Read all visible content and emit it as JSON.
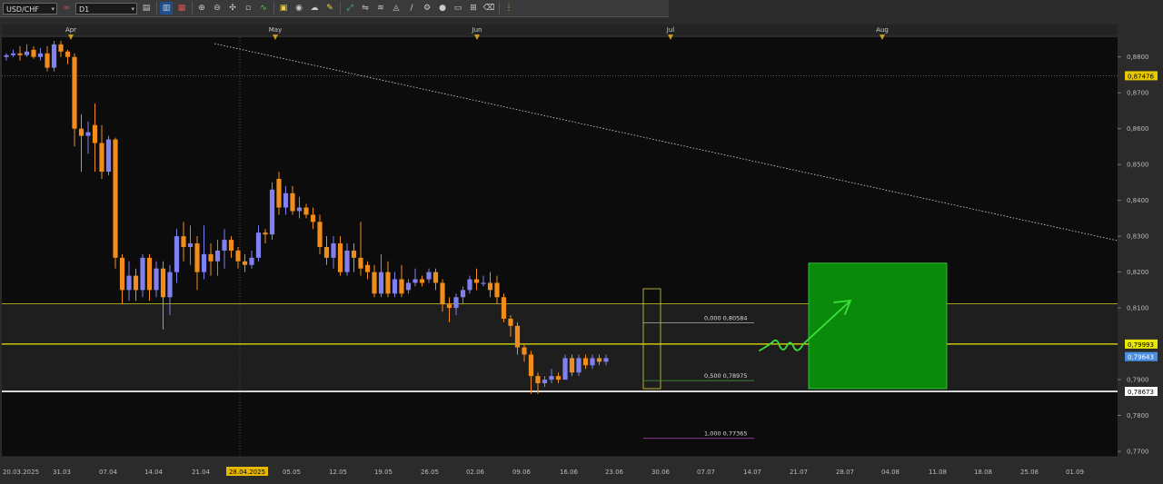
{
  "toolbar": {
    "symbol": "USD/CHF",
    "timeframe": "D1",
    "icons": [
      "chart-type-icon",
      "bar-style-icon",
      "line-style-icon",
      "zoom-in-icon",
      "zoom-out-icon",
      "crosshair-icon",
      "grid-icon",
      "indicator-icon",
      "template-icon",
      "screenshot-icon",
      "pencil-icon",
      "line-tool-icon",
      "channel-tool-icon",
      "fibo-tool-icon",
      "shapes-icon",
      "text-tool-icon",
      "settings-icon",
      "eraser-icon",
      "more-icon"
    ]
  },
  "chart_data": {
    "type": "candlestick",
    "symbol": "USD/CHF",
    "timeframe": "D1",
    "ylim": [
      0.7685,
      0.8855
    ],
    "y_ticks": [
      "0,8800",
      "0,8700",
      "0,8600",
      "0,8500",
      "0,8400",
      "0,8300",
      "0,8200",
      "0,8100",
      "0,7900",
      "0,7800",
      "0,7700"
    ],
    "month_labels": [
      "Apr",
      "May",
      "Jun",
      "Jul",
      "Aug"
    ],
    "date_labels": [
      "20.03.2025",
      "31.03",
      "07.04",
      "14.04",
      "21.04",
      "28.04.2025",
      "05.05",
      "12.05",
      "19.05",
      "26.05",
      "02.06",
      "09.06",
      "16.06",
      "23.06",
      "30.06",
      "07.07",
      "14.07",
      "21.07",
      "28.07",
      "04.08",
      "11.08",
      "18.08",
      "25.08",
      "01.09"
    ],
    "price_tags": [
      {
        "label": "0,87476",
        "value": 0.87476,
        "bg": "#e8c800",
        "fg": "#000000"
      },
      {
        "label": "0,79993",
        "value": 0.79993,
        "bg": "#e8e800",
        "fg": "#000000"
      },
      {
        "label": "0,79643",
        "value": 0.79643,
        "bg": "#4a8fe0",
        "fg": "#ffffff"
      },
      {
        "label": "0,78673",
        "value": 0.78673,
        "bg": "#ffffff",
        "fg": "#000000"
      }
    ],
    "horizontal_levels": [
      0.8112,
      0.79993,
      0.78673
    ],
    "fib_levels": [
      {
        "label": "0,000 0,80584",
        "value": 0.80584
      },
      {
        "label": "0,500 0,78975",
        "value": 0.78975
      },
      {
        "label": "1,000 0,77365",
        "value": 0.77365
      }
    ],
    "target_zone": {
      "top": 0.8225,
      "bottom": 0.7875,
      "color": "#0a8a0a"
    },
    "colors": {
      "bull": "#8080f0",
      "bear": "#f08c1c",
      "background": "#0c0c0c",
      "zone": "#1e1e1e"
    },
    "candles": [
      [
        0.88,
        0.8805,
        0.879,
        0.881
      ],
      [
        0.8805,
        0.881,
        0.88,
        0.882
      ],
      [
        0.881,
        0.8805,
        0.879,
        0.883
      ],
      [
        0.8805,
        0.8815,
        0.88,
        0.8835
      ],
      [
        0.882,
        0.88,
        0.8795,
        0.883
      ],
      [
        0.88,
        0.881,
        0.879,
        0.8825
      ],
      [
        0.881,
        0.877,
        0.876,
        0.883
      ],
      [
        0.877,
        0.8835,
        0.876,
        0.8845
      ],
      [
        0.8835,
        0.8815,
        0.88,
        0.8845
      ],
      [
        0.8815,
        0.88,
        0.878,
        0.882
      ],
      [
        0.88,
        0.86,
        0.855,
        0.881
      ],
      [
        0.86,
        0.858,
        0.848,
        0.864
      ],
      [
        0.858,
        0.859,
        0.853,
        0.862
      ],
      [
        0.861,
        0.856,
        0.848,
        0.867
      ],
      [
        0.856,
        0.848,
        0.846,
        0.861
      ],
      [
        0.848,
        0.857,
        0.847,
        0.858
      ],
      [
        0.857,
        0.824,
        0.821,
        0.8575
      ],
      [
        0.824,
        0.815,
        0.811,
        0.825
      ],
      [
        0.815,
        0.819,
        0.812,
        0.823
      ],
      [
        0.819,
        0.815,
        0.812,
        0.821
      ],
      [
        0.815,
        0.824,
        0.813,
        0.825
      ],
      [
        0.824,
        0.815,
        0.812,
        0.825
      ],
      [
        0.815,
        0.821,
        0.813,
        0.823
      ],
      [
        0.821,
        0.813,
        0.804,
        0.823
      ],
      [
        0.813,
        0.82,
        0.808,
        0.822
      ],
      [
        0.82,
        0.83,
        0.817,
        0.832
      ],
      [
        0.83,
        0.827,
        0.823,
        0.834
      ],
      [
        0.827,
        0.828,
        0.822,
        0.833
      ],
      [
        0.828,
        0.82,
        0.815,
        0.83
      ],
      [
        0.82,
        0.825,
        0.818,
        0.833
      ],
      [
        0.825,
        0.823,
        0.819,
        0.828
      ],
      [
        0.823,
        0.826,
        0.819,
        0.829
      ],
      [
        0.826,
        0.829,
        0.821,
        0.832
      ],
      [
        0.829,
        0.826,
        0.824,
        0.83
      ],
      [
        0.826,
        0.823,
        0.821,
        0.827
      ],
      [
        0.823,
        0.822,
        0.82,
        0.825
      ],
      [
        0.822,
        0.824,
        0.821,
        0.826
      ],
      [
        0.824,
        0.831,
        0.823,
        0.833
      ],
      [
        0.831,
        0.8305,
        0.828,
        0.832
      ],
      [
        0.8305,
        0.843,
        0.829,
        0.845
      ],
      [
        0.846,
        0.838,
        0.836,
        0.848
      ],
      [
        0.838,
        0.842,
        0.836,
        0.844
      ],
      [
        0.842,
        0.837,
        0.836,
        0.844
      ],
      [
        0.837,
        0.838,
        0.835,
        0.841
      ],
      [
        0.838,
        0.836,
        0.835,
        0.839
      ],
      [
        0.836,
        0.834,
        0.832,
        0.838
      ],
      [
        0.834,
        0.827,
        0.825,
        0.836
      ],
      [
        0.827,
        0.824,
        0.822,
        0.83
      ],
      [
        0.824,
        0.828,
        0.821,
        0.83
      ],
      [
        0.828,
        0.82,
        0.819,
        0.83
      ],
      [
        0.82,
        0.826,
        0.819,
        0.828
      ],
      [
        0.826,
        0.824,
        0.82,
        0.828
      ],
      [
        0.824,
        0.821,
        0.819,
        0.834
      ],
      [
        0.822,
        0.82,
        0.818,
        0.823
      ],
      [
        0.82,
        0.814,
        0.813,
        0.822
      ],
      [
        0.814,
        0.82,
        0.813,
        0.825
      ],
      [
        0.82,
        0.814,
        0.813,
        0.823
      ],
      [
        0.814,
        0.818,
        0.813,
        0.82
      ],
      [
        0.818,
        0.814,
        0.813,
        0.822
      ],
      [
        0.815,
        0.817,
        0.814,
        0.818
      ],
      [
        0.817,
        0.818,
        0.816,
        0.821
      ],
      [
        0.818,
        0.817,
        0.816,
        0.819
      ],
      [
        0.818,
        0.82,
        0.817,
        0.821
      ],
      [
        0.82,
        0.817,
        0.815,
        0.821
      ],
      [
        0.817,
        0.811,
        0.809,
        0.818
      ],
      [
        0.811,
        0.81,
        0.806,
        0.813
      ],
      [
        0.81,
        0.813,
        0.808,
        0.814
      ],
      [
        0.813,
        0.815,
        0.811,
        0.816
      ],
      [
        0.815,
        0.818,
        0.814,
        0.819
      ],
      [
        0.818,
        0.817,
        0.815,
        0.821
      ],
      [
        0.817,
        0.817,
        0.816,
        0.819
      ],
      [
        0.817,
        0.815,
        0.813,
        0.82
      ],
      [
        0.817,
        0.813,
        0.811,
        0.819
      ],
      [
        0.813,
        0.807,
        0.806,
        0.814
      ],
      [
        0.807,
        0.805,
        0.802,
        0.808
      ],
      [
        0.805,
        0.799,
        0.797,
        0.806
      ],
      [
        0.799,
        0.797,
        0.795,
        0.8
      ],
      [
        0.797,
        0.791,
        0.786,
        0.798
      ],
      [
        0.791,
        0.789,
        0.786,
        0.792
      ],
      [
        0.789,
        0.79,
        0.788,
        0.791
      ],
      [
        0.79,
        0.791,
        0.789,
        0.793
      ],
      [
        0.791,
        0.79,
        0.789,
        0.792
      ],
      [
        0.79,
        0.796,
        0.79,
        0.797
      ],
      [
        0.796,
        0.792,
        0.791,
        0.797
      ],
      [
        0.792,
        0.796,
        0.791,
        0.797
      ],
      [
        0.796,
        0.794,
        0.793,
        0.797
      ],
      [
        0.794,
        0.796,
        0.793,
        0.797
      ],
      [
        0.796,
        0.795,
        0.794,
        0.797
      ],
      [
        0.795,
        0.796,
        0.794,
        0.797
      ]
    ]
  }
}
